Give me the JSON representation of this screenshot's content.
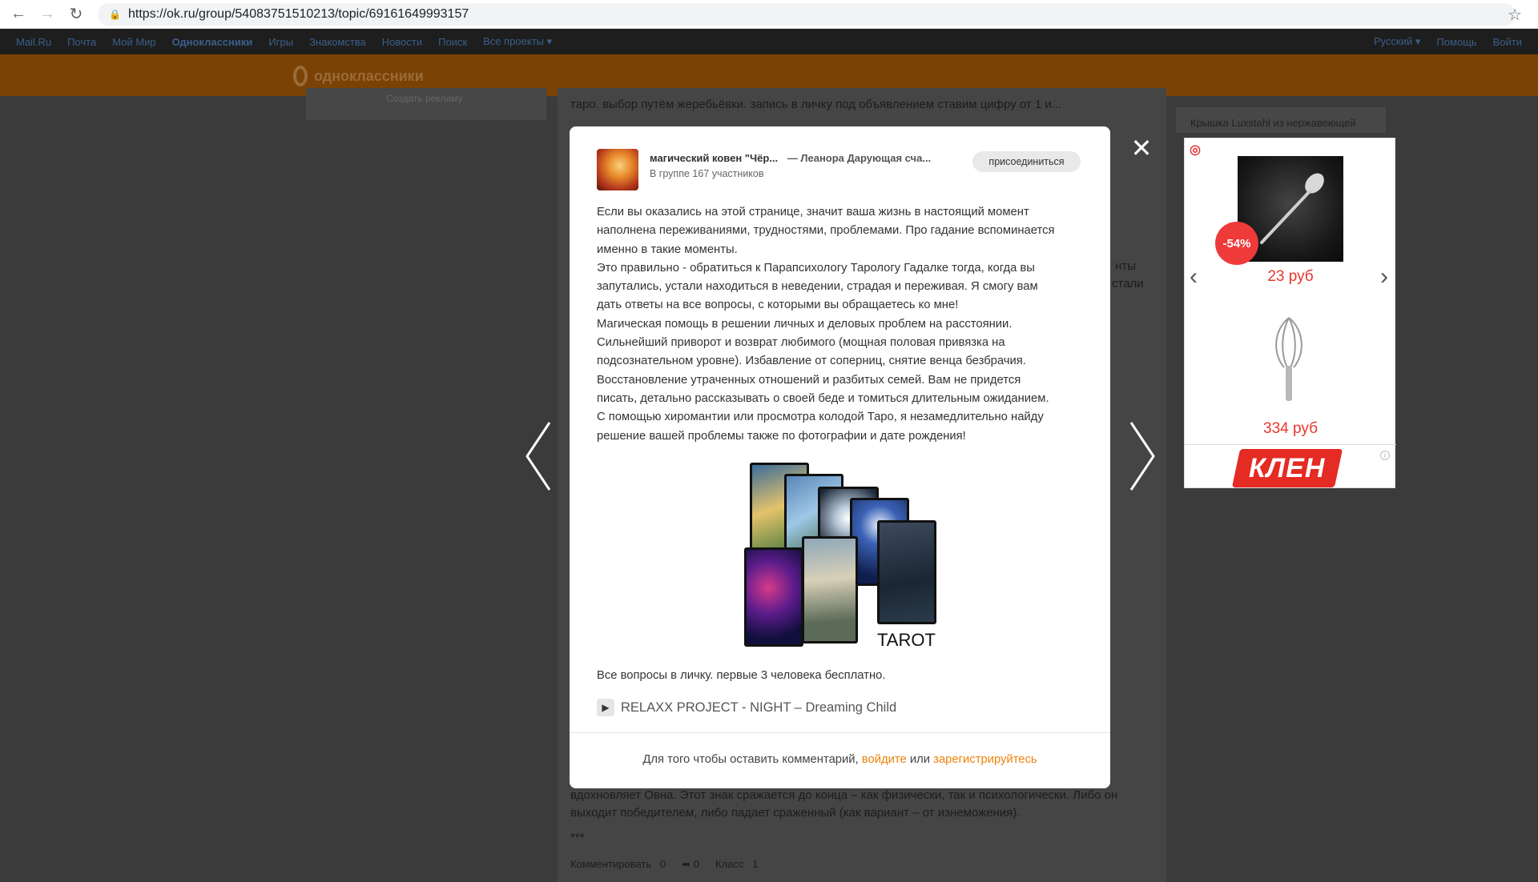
{
  "browser": {
    "url": "https://ok.ru/group/54083751510213/topic/69161649993157"
  },
  "mailbar": {
    "items": [
      "Mail.Ru",
      "Почта",
      "Мой Мир",
      "Одноклассники",
      "Игры",
      "Знакомства",
      "Новости",
      "Поиск",
      "Все проекты ▾"
    ],
    "right_items": [
      "Русский ▾",
      "Помощь",
      "Войти"
    ]
  },
  "ok_header": {
    "logo_text": "одноклассники"
  },
  "background": {
    "left_card_text": "Создать рекламу",
    "top_text": "таро. выбор путём жеребьёвки. запись в личку под объявлением ставим цифру от 1 и...",
    "side_text_1": "нты",
    "side_text_2": "стали",
    "bottom_text_1": "вдохновляет Овна. Этот знак сражается до конца – как физически, так и психологически. Либо он",
    "bottom_text_2": "выходит победителем, либо падает сраженный (как вариант – от изнеможения).",
    "bottom_text_3": "***",
    "ad_title": "Крышка Luxstahl из нержавеющей",
    "action_comment": "Комментировать",
    "action_comment_count": "0",
    "action_share_count": "0",
    "action_like": "Класс",
    "action_like_count": "1"
  },
  "modal": {
    "group_name": "магический ковен \"Чёр...",
    "topic_title": "— Леанора Дарующая сча...",
    "members": "В группе 167 участников",
    "join_label": "присоединиться",
    "body_lines": [
      "Если вы оказались на этой странице, значит ваша жизнь в настоящий момент",
      "наполнена переживаниями, трудностями, проблемами. Про гадание вспоминается",
      "именно в такие моменты.",
      "Это правильно - обратиться к Парапсихологу Тарологу  Гадалке тогда, когда вы",
      "запутались, устали находиться в неведении, страдая и переживая. Я смогу вам",
      "дать ответы на все вопросы, с которыми вы обращаетесь ко мне!",
      "Магическая помощь в решении личных и деловых проблем на расстоянии.",
      "Сильнейший приворот и возврат любимого (мощная половая привязка на",
      "подсознательном уровне). Избавление от соперниц, снятие венца безбрачия.",
      "Восстановление утраченных отношений и разбитых семей. Вам не придется",
      "писать, детально рассказывать о своей беде и томиться длительным ожиданием.",
      "С помощью хиромантии или просмотра колодой Таро, я незамедлительно найду",
      "решение вашей проблемы также по фотографии и дате рождения!"
    ],
    "image_caption": "TAROT",
    "footer_text": "Все вопросы в личку. первые 3 человека бесплатно.",
    "music_track": "RELAXX PROJECT - NIGHT – Dreaming Child",
    "comment_prefix": "Для того чтобы оставить комментарий,",
    "comment_login": "войдите",
    "comment_or": "или",
    "comment_register": "зарегистрируйтесь"
  },
  "ad": {
    "discount": "-54%",
    "price_1": "23 руб",
    "price_2": "334 руб",
    "brand": "КЛЕН"
  },
  "colors": {
    "ok_orange": "#ee8208",
    "price_red": "#e8352a",
    "overlay": "#3b3b3b"
  }
}
